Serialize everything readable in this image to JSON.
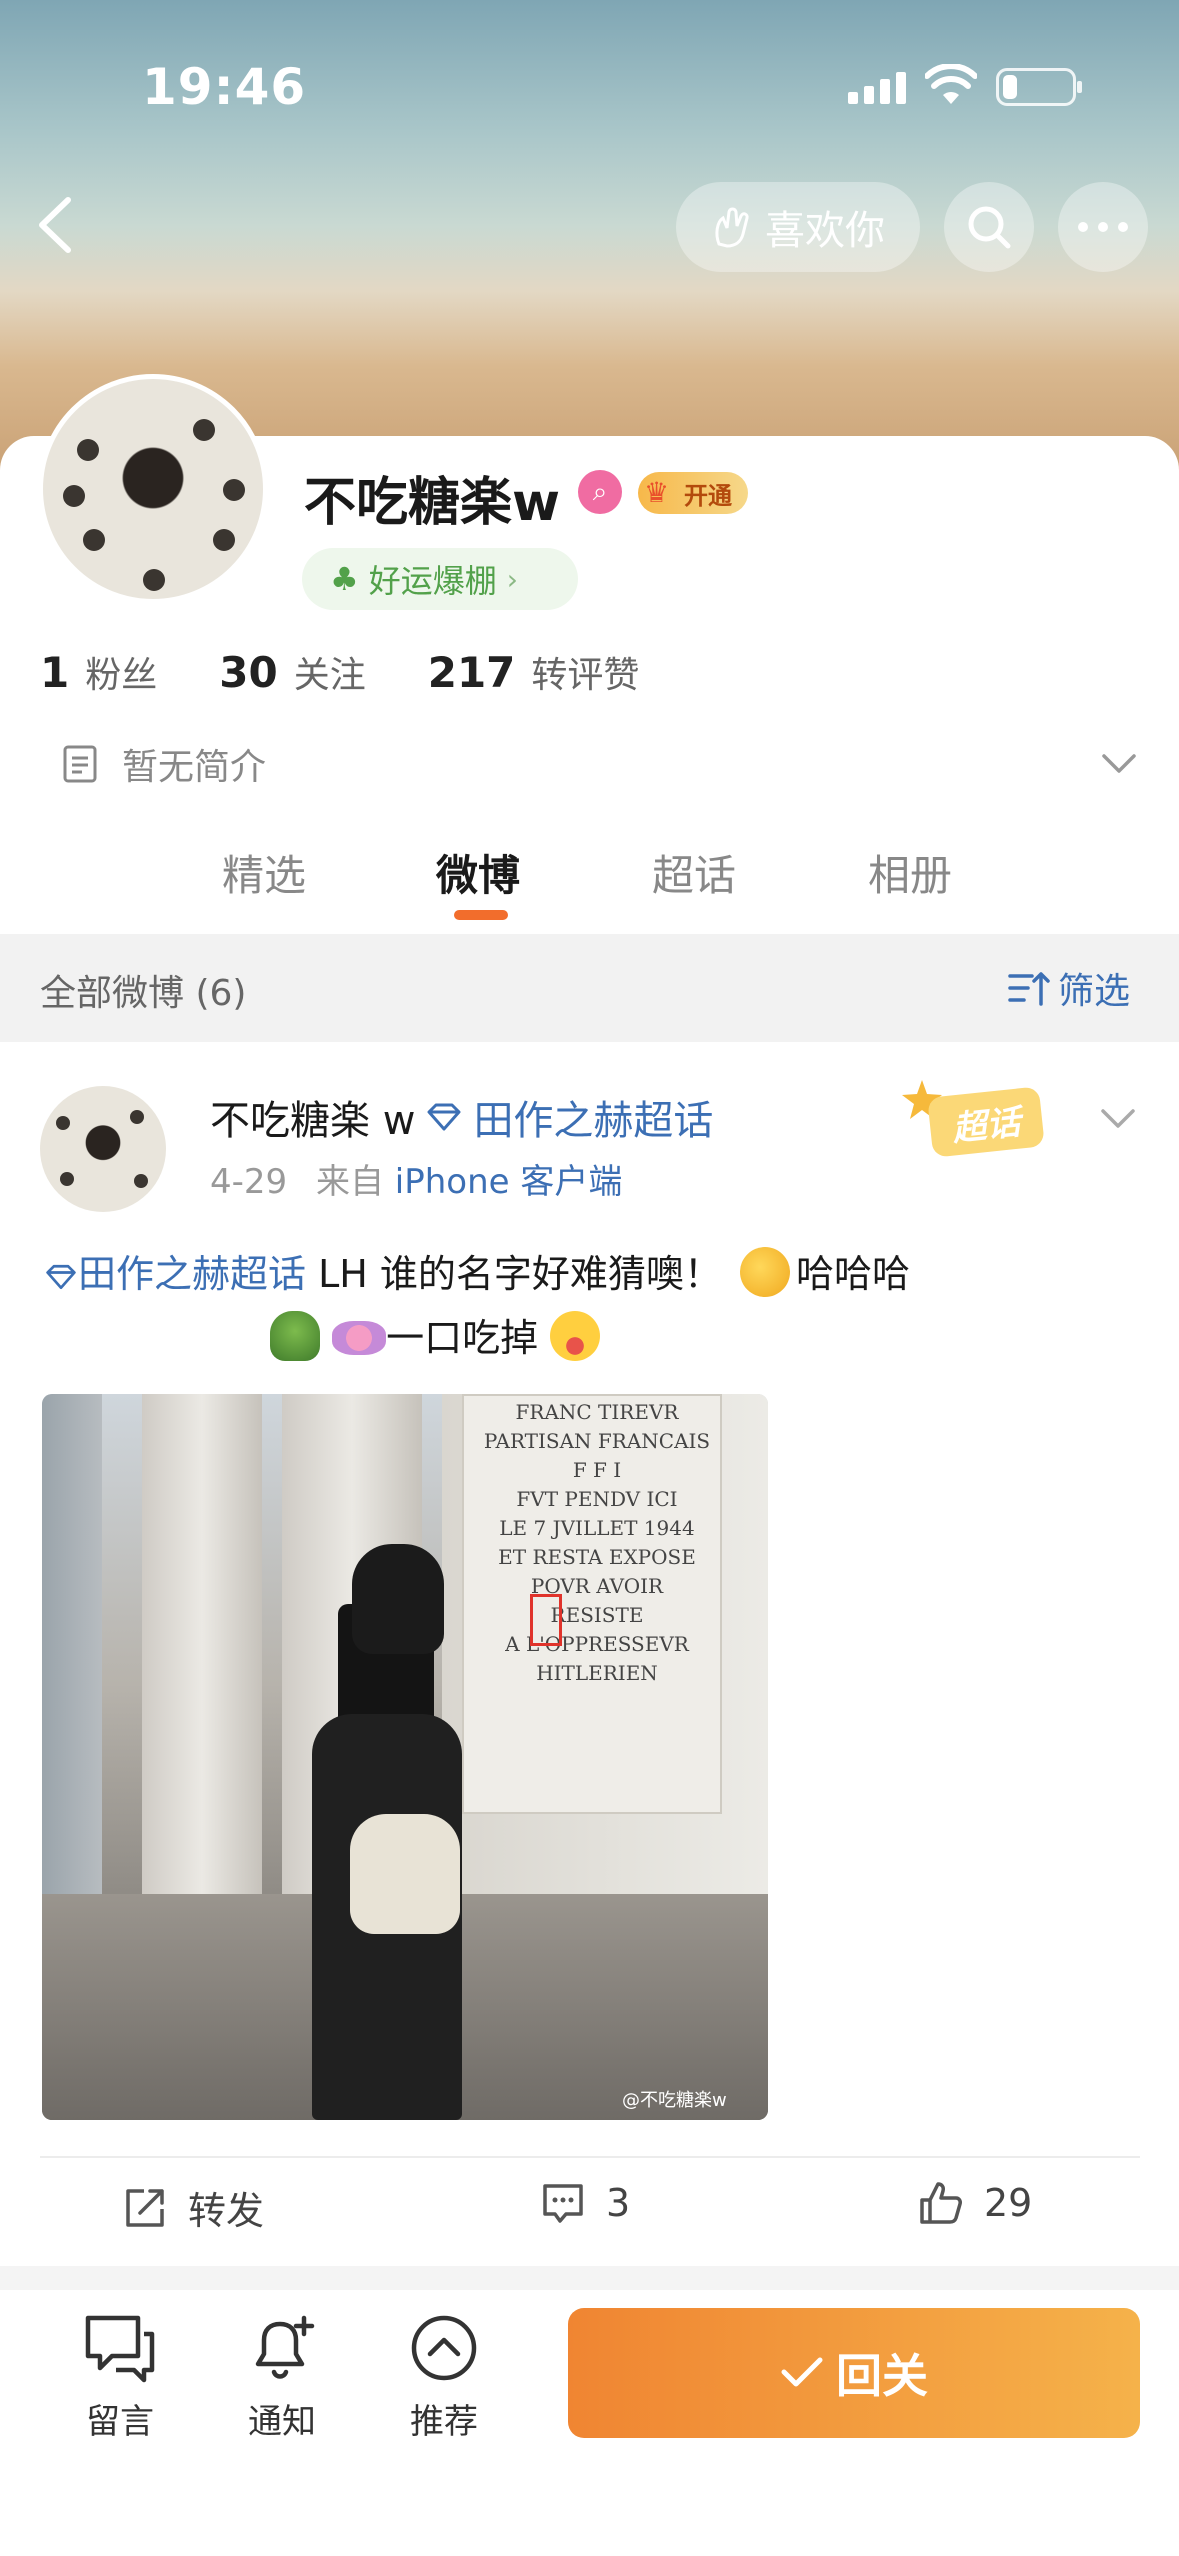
{
  "status_bar": {
    "time": "19:46"
  },
  "header": {
    "like_label": "喜欢你"
  },
  "profile": {
    "name": "不吃糖楽w",
    "vip_label": "开通",
    "luck_label": "好运爆棚",
    "stats": [
      {
        "value": "1",
        "label": "粉丝"
      },
      {
        "value": "30",
        "label": "关注"
      },
      {
        "value": "217",
        "label": "转评赞"
      }
    ],
    "bio": "暂无简介"
  },
  "tabs": [
    {
      "label": "精选"
    },
    {
      "label": "微博"
    },
    {
      "label": "超话"
    },
    {
      "label": "相册"
    }
  ],
  "filter": {
    "left_label": "全部微博 (6)",
    "right_label": "筛选"
  },
  "post": {
    "user": "不吃糖楽 w",
    "topic_tag": "田作之赫超话",
    "date": "4-29",
    "source_prefix": "来自",
    "source": "iPhone 客户端",
    "sticker": "超话",
    "text_topic": "田作之赫超话",
    "text_line1": " LH 谁的名字好难猜噢！",
    "text_line1_tail": "哈哈哈",
    "text_line2": "一口吃掉",
    "photo_plaque": "FRANC TIREVR\nPARTISAN FRANCAIS\nF F I\nFVT PENDV ICI\nLE 7 JVILLET 1944\nET RESTA EXPOSE\nPOVR AVOIR RESISTE\nA L'OPPRESSEVR\nHITLERIEN",
    "watermark": "@不吃糖楽w",
    "repost_label": "转发",
    "comment_count": "3",
    "like_count": "29"
  },
  "bottom_bar": {
    "comment_label": "留言",
    "notify_label": "通知",
    "recommend_label": "推荐",
    "follow_back_label": "回关"
  },
  "colors": {
    "accent": "#f26d2c",
    "link": "#3c6fb4",
    "button_start": "#f08532",
    "button_end": "#f5b24a"
  }
}
